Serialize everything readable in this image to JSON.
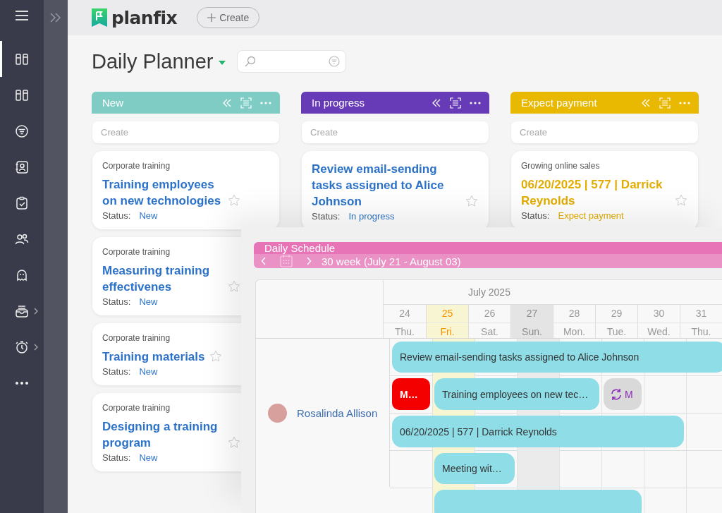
{
  "sidebar": {
    "items": [
      {
        "selected": true,
        "submenu": false
      },
      {
        "selected": false,
        "submenu": false
      },
      {
        "selected": false,
        "submenu": false
      },
      {
        "selected": false,
        "submenu": false
      },
      {
        "selected": false,
        "submenu": false
      },
      {
        "selected": false,
        "submenu": false
      },
      {
        "selected": false,
        "submenu": false
      },
      {
        "selected": false,
        "submenu": true
      },
      {
        "selected": false,
        "submenu": true
      },
      {
        "selected": false,
        "submenu": false
      }
    ]
  },
  "top_bar": {
    "logo": "planfix",
    "create_button": "Create"
  },
  "page": {
    "title": "Daily Planner"
  },
  "columns": [
    {
      "title": "New",
      "color": "#7fccc4",
      "create_placeholder": "Create",
      "cards": [
        {
          "project": "Corporate training",
          "title": "Training employees on new technologies",
          "starred": false,
          "status_label": "Status:",
          "status": "New",
          "color": "#2b72c8"
        },
        {
          "project": "Corporate training",
          "title": "Measuring training effectivenes",
          "starred": false,
          "status_label": "Status:",
          "status": "New",
          "color": "#2b72c8"
        },
        {
          "project": "Corporate training",
          "title": "Training materials",
          "starred": false,
          "status_label": "Status:",
          "status": "New",
          "color": "#2b72c8"
        },
        {
          "project": "Corporate training",
          "title": "Designing a training program",
          "starred": false,
          "status_label": "Status:",
          "status": "New",
          "color": "#2b72c8"
        }
      ]
    },
    {
      "title": "In progress",
      "color": "#673ab7",
      "create_placeholder": "Create",
      "cards": [
        {
          "title": "Review email-sending tasks assigned to Alice Johnson",
          "starred": false,
          "status_label": "Status:",
          "status": "In progress",
          "color": "#2b72c8"
        }
      ]
    },
    {
      "title": "Expect payment",
      "color": "#e9b800",
      "create_placeholder": "Create",
      "cards": [
        {
          "project": "Growing online sales",
          "title": "06/20/2025 | 577 | Darrick Reynolds",
          "starred": false,
          "status_label": "Status:",
          "status": "Expect payment",
          "color": "#e3ac00"
        }
      ]
    }
  ],
  "schedule": {
    "title": "Daily Schedule",
    "week": "30 week (July 21 - August 03)",
    "month": "July 2025",
    "days": [
      {
        "date": "24",
        "weekday": "Thu.",
        "today": false,
        "weekend": false
      },
      {
        "date": "25",
        "weekday": "Fri.",
        "today": true,
        "weekend": false
      },
      {
        "date": "26",
        "weekday": "Sat.",
        "today": false,
        "weekend": false
      },
      {
        "date": "27",
        "weekday": "Sun.",
        "today": false,
        "weekend": true
      },
      {
        "date": "28",
        "weekday": "Mon.",
        "today": false,
        "weekend": false
      },
      {
        "date": "29",
        "weekday": "Tue.",
        "today": false,
        "weekend": false
      },
      {
        "date": "30",
        "weekday": "Wed.",
        "today": false,
        "weekend": false
      },
      {
        "date": "31",
        "weekday": "Thu.",
        "today": false,
        "weekend": false
      }
    ],
    "person": {
      "name": "Rosalinda Allison"
    },
    "events": [
      {
        "kind": "task",
        "title": "Review email-sending tasks assigned to Alice Johnson"
      },
      {
        "kind": "overdue",
        "title": "M…"
      },
      {
        "kind": "task",
        "title": "Training employees on new tec…"
      },
      {
        "kind": "recurring",
        "title": "M"
      },
      {
        "kind": "task",
        "title": "06/20/2025 | 577 | Darrick Reynolds"
      },
      {
        "kind": "task",
        "title": "Meeting wit…"
      },
      {
        "kind": "task"
      }
    ]
  }
}
